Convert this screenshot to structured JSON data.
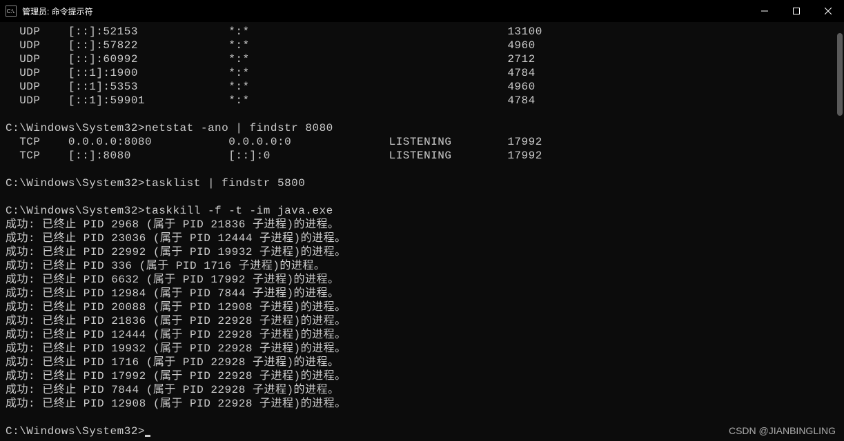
{
  "window": {
    "title": "管理员: 命令提示符",
    "icon_label": "C:\\."
  },
  "udp_rows": [
    {
      "proto": "UDP",
      "local": "[::]:52153",
      "foreign": "*:*",
      "pid": "13100"
    },
    {
      "proto": "UDP",
      "local": "[::]:57822",
      "foreign": "*:*",
      "pid": "4960"
    },
    {
      "proto": "UDP",
      "local": "[::]:60992",
      "foreign": "*:*",
      "pid": "2712"
    },
    {
      "proto": "UDP",
      "local": "[::1]:1900",
      "foreign": "*:*",
      "pid": "4784"
    },
    {
      "proto": "UDP",
      "local": "[::1]:5353",
      "foreign": "*:*",
      "pid": "4960"
    },
    {
      "proto": "UDP",
      "local": "[::1]:59901",
      "foreign": "*:*",
      "pid": "4784"
    }
  ],
  "prompts": {
    "p1_path": "C:\\Windows\\System32>",
    "p1_cmd": "netstat -ano | findstr 8080",
    "p2_path": "C:\\Windows\\System32>",
    "p2_cmd": "tasklist | findstr 5800",
    "p3_path": "C:\\Windows\\System32>",
    "p3_cmd": "taskkill -f -t -im java.exe",
    "p4_path": "C:\\Windows\\System32>"
  },
  "tcp_rows": [
    {
      "proto": "TCP",
      "local": "0.0.0.0:8080",
      "foreign": "0.0.0.0:0",
      "state": "LISTENING",
      "pid": "17992"
    },
    {
      "proto": "TCP",
      "local": "[::]:8080",
      "foreign": "[::]:0",
      "state": "LISTENING",
      "pid": "17992"
    }
  ],
  "kill_results": [
    {
      "prefix": "成功: 已终止 PID ",
      "pid": "2968",
      "mid": " (属于 PID ",
      "ppid": "21836",
      "suffix": " 子进程)的进程。"
    },
    {
      "prefix": "成功: 已终止 PID ",
      "pid": "23036",
      "mid": " (属于 PID ",
      "ppid": "12444",
      "suffix": " 子进程)的进程。"
    },
    {
      "prefix": "成功: 已终止 PID ",
      "pid": "22992",
      "mid": " (属于 PID ",
      "ppid": "19932",
      "suffix": " 子进程)的进程。"
    },
    {
      "prefix": "成功: 已终止 PID ",
      "pid": "336",
      "mid": " (属于 PID ",
      "ppid": "1716",
      "suffix": " 子进程)的进程。"
    },
    {
      "prefix": "成功: 已终止 PID ",
      "pid": "6632",
      "mid": " (属于 PID ",
      "ppid": "17992",
      "suffix": " 子进程)的进程。"
    },
    {
      "prefix": "成功: 已终止 PID ",
      "pid": "12984",
      "mid": " (属于 PID ",
      "ppid": "7844",
      "suffix": " 子进程)的进程。"
    },
    {
      "prefix": "成功: 已终止 PID ",
      "pid": "20088",
      "mid": " (属于 PID ",
      "ppid": "12908",
      "suffix": " 子进程)的进程。"
    },
    {
      "prefix": "成功: 已终止 PID ",
      "pid": "21836",
      "mid": " (属于 PID ",
      "ppid": "22928",
      "suffix": " 子进程)的进程。"
    },
    {
      "prefix": "成功: 已终止 PID ",
      "pid": "12444",
      "mid": " (属于 PID ",
      "ppid": "22928",
      "suffix": " 子进程)的进程。"
    },
    {
      "prefix": "成功: 已终止 PID ",
      "pid": "19932",
      "mid": " (属于 PID ",
      "ppid": "22928",
      "suffix": " 子进程)的进程。"
    },
    {
      "prefix": "成功: 已终止 PID ",
      "pid": "1716",
      "mid": " (属于 PID ",
      "ppid": "22928",
      "suffix": " 子进程)的进程。"
    },
    {
      "prefix": "成功: 已终止 PID ",
      "pid": "17992",
      "mid": " (属于 PID ",
      "ppid": "22928",
      "suffix": " 子进程)的进程。"
    },
    {
      "prefix": "成功: 已终止 PID ",
      "pid": "7844",
      "mid": " (属于 PID ",
      "ppid": "22928",
      "suffix": " 子进程)的进程。"
    },
    {
      "prefix": "成功: 已终止 PID ",
      "pid": "12908",
      "mid": " (属于 PID ",
      "ppid": "22928",
      "suffix": " 子进程)的进程。"
    }
  ],
  "watermark": "CSDN @JIANBINGLING"
}
